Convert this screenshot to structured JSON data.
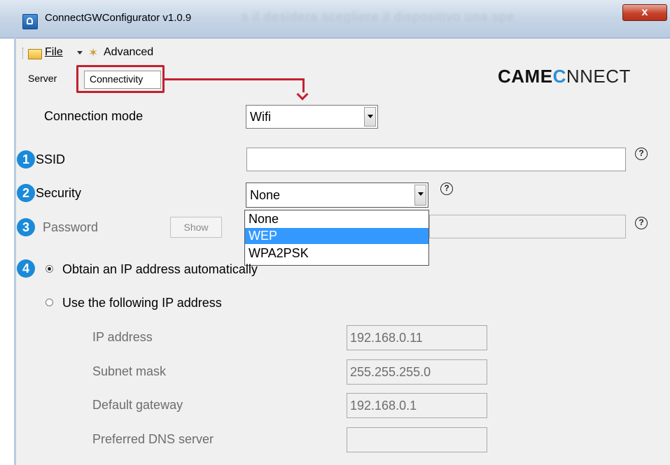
{
  "window": {
    "title": "ConnectGWConfigurator v1.0.9",
    "background_text": "s il desidera scegliere il dispositivo una spe",
    "close_glyph": "x"
  },
  "menu": {
    "file": "File",
    "advanced": "Advanced"
  },
  "tabs": [
    {
      "label": "Server"
    },
    {
      "label": "Connectivity",
      "selected": true
    }
  ],
  "logo": {
    "part1": "CAME",
    "part2": "C",
    "part3": "NNECT"
  },
  "form": {
    "connection_mode_label": "Connection mode",
    "connection_mode_value": "Wifi",
    "ssid_label": "SSID",
    "ssid_value": "",
    "security_label": "Security",
    "security_value": "None",
    "security_options": [
      "None",
      "WEP",
      "WPA2PSK"
    ],
    "security_highlighted": "WEP",
    "password_label": "Password",
    "show_button": "Show",
    "help_glyph": "?",
    "obtain_auto_label": "Obtain an IP address automatically",
    "use_following_label": "Use the following IP address",
    "ip_label": "IP address",
    "ip_value": "192.168.0.11",
    "subnet_label": "Subnet mask",
    "subnet_value": "255.255.255.0",
    "gateway_label": "Default gateway",
    "gateway_value": "192.168.0.1",
    "dns_label": "Preferred DNS server",
    "dns_value": ""
  },
  "badges": [
    "1",
    "2",
    "3",
    "4"
  ],
  "colors": {
    "highlight": "#c2212f",
    "badge": "#1b8ad9",
    "selection": "#3399ff",
    "logo_accent": "#2a8fd6"
  }
}
